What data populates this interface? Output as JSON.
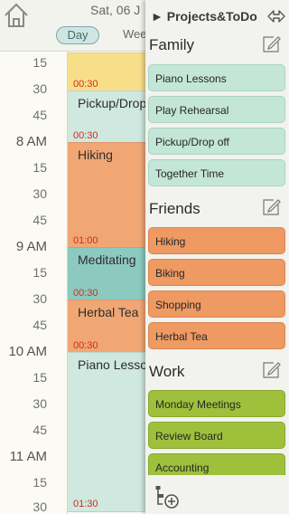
{
  "header": {
    "date": "Sat, 06 J",
    "views": {
      "day": "Day",
      "week": "Wee"
    }
  },
  "calendar": {
    "time_labels": [
      "15",
      "30",
      "45",
      "8 AM",
      "15",
      "30",
      "45",
      "9 AM",
      "15",
      "30",
      "45",
      "10 AM",
      "15",
      "30",
      "45",
      "11 AM",
      "15",
      "30"
    ],
    "events": [
      {
        "title": "",
        "duration": "00:30",
        "color": "#f7df8a"
      },
      {
        "title": "Pickup/Drop",
        "duration": "00:30",
        "color": "#cfe9e0"
      },
      {
        "title": "Hiking",
        "duration": "01:00",
        "color": "#f0a774"
      },
      {
        "title": "Meditating",
        "duration": "00:30",
        "color": "#8ccac0"
      },
      {
        "title": "Herbal Tea",
        "duration": "00:30",
        "color": "#f0a774"
      },
      {
        "title": "Piano Lesso",
        "duration": "01:30",
        "color": "#cfe9e0"
      }
    ]
  },
  "panel": {
    "title": "Projects&ToDo",
    "groups": [
      {
        "name": "Family",
        "items": [
          "Piano Lessons",
          "Play Rehearsal",
          "Pickup/Drop off",
          "Together Time"
        ]
      },
      {
        "name": "Friends",
        "items": [
          "Hiking",
          "Biking",
          "Shopping",
          "Herbal Tea"
        ]
      },
      {
        "name": "Work",
        "items": [
          "Monday Meetings",
          "Review Board",
          "Accounting"
        ]
      }
    ]
  },
  "colors": {
    "family": "#c3e6d8",
    "friends": "#ef9a63",
    "work": "#9ec03b",
    "accent": "#7aa9a6"
  },
  "icons": {
    "home": "home-icon",
    "collapse": "double-arrow-icon",
    "edit": "edit-icon",
    "add": "add-project-icon"
  }
}
